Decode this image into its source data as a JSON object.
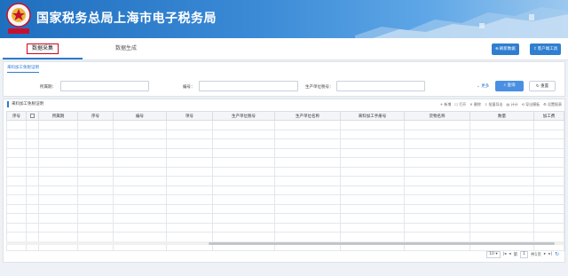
{
  "header": {
    "title": "国家税务总局上海市电子税务局"
  },
  "tabs": [
    {
      "label": "数据采集",
      "active": true
    },
    {
      "label": "数据生成",
      "active": false
    }
  ],
  "top_buttons": {
    "new_data": "刷新数据",
    "customer_tool": "客户端工具"
  },
  "query": {
    "title": "来料加工免税证明",
    "fields": [
      {
        "label": "所属期：",
        "value": ""
      },
      {
        "label": "编号：",
        "value": ""
      },
      {
        "label": "生产单位税号：",
        "value": ""
      }
    ],
    "more": "更多",
    "search": "查询",
    "reset": "重置"
  },
  "list": {
    "title": "来料加工免税证明",
    "tools": [
      "新增",
      "打开",
      "删除",
      "批量导出",
      "计计",
      "导出模板",
      "设置报表"
    ],
    "columns": [
      "序号",
      "",
      "所属期",
      "序号",
      "编号",
      "项号",
      "生产单位税号",
      "生产单位名称",
      "来料加工手册号",
      "货物名称",
      "数量",
      "加工费"
    ],
    "rows": 14
  },
  "pager": {
    "page_size": "10",
    "page_label": "第",
    "page": "1",
    "total": "共1页"
  },
  "colors": {
    "accent": "#2e7bcf",
    "header": "#1f6fbf",
    "highlight": "#d0021b"
  }
}
